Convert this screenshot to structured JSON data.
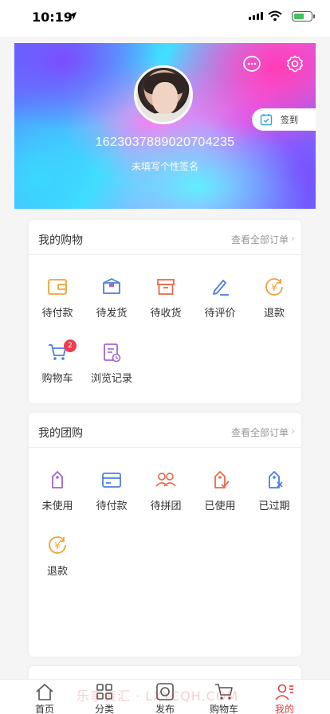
{
  "status_bar": {
    "time": "10:19"
  },
  "profile": {
    "user_id": "1623037889020704235",
    "signature": "未填写个性签名",
    "checkin_label": "签到"
  },
  "shopping": {
    "title": "我的购物",
    "view_all": "查看全部订单",
    "items": [
      {
        "label": "待付款",
        "icon": "wallet-icon"
      },
      {
        "label": "待发货",
        "icon": "package-box-icon"
      },
      {
        "label": "待收货",
        "icon": "archive-box-icon"
      },
      {
        "label": "待评价",
        "icon": "pen-icon"
      },
      {
        "label": "退款",
        "icon": "refund-coin-icon"
      },
      {
        "label": "购物车",
        "icon": "cart-icon",
        "badge": "2"
      },
      {
        "label": "浏览记录",
        "icon": "history-icon"
      }
    ]
  },
  "group_buy": {
    "title": "我的团购",
    "view_all": "查看全部订单",
    "items": [
      {
        "label": "未使用",
        "icon": "tag-icon"
      },
      {
        "label": "待付款",
        "icon": "card-icon"
      },
      {
        "label": "待拼团",
        "icon": "group-icon"
      },
      {
        "label": "已使用",
        "icon": "tag-check-icon"
      },
      {
        "label": "已过期",
        "icon": "tag-expired-icon"
      },
      {
        "label": "退款",
        "icon": "refund-coin-icon"
      }
    ]
  },
  "tabbar": {
    "items": [
      {
        "label": "首页",
        "icon": "home-icon"
      },
      {
        "label": "分类",
        "icon": "grid-icon"
      },
      {
        "label": "发布",
        "icon": "publish-icon"
      },
      {
        "label": "购物车",
        "icon": "cart-icon"
      },
      {
        "label": "我的",
        "icon": "profile-icon",
        "active": true
      }
    ]
  },
  "watermark": "乐享资汇 · LXYCQH.COM",
  "colors": {
    "accent": "#e23b3b",
    "orange": "#f0a23a",
    "blue": "#4a7fe0",
    "purple": "#a066d3",
    "badge": "#f03c4d"
  }
}
